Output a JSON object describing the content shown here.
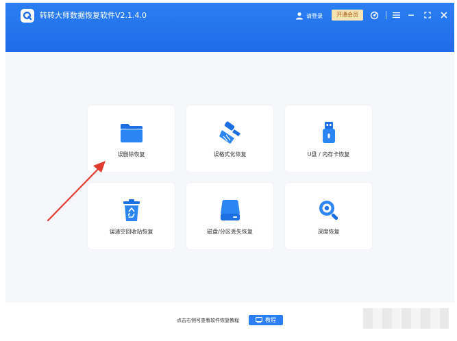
{
  "app": {
    "title": "转转大师数据恢复软件V2.1.4.0",
    "login_label": "请登录",
    "vip_label": "开通会员"
  },
  "colors": {
    "titlebar": "#1f6be8",
    "accent": "#2b7ff2",
    "vip_bg": "#f6e3b4",
    "vip_text": "#a0580e",
    "annotation_arrow": "#e23b2f"
  },
  "icons": {
    "logo": "logo-q-icon",
    "user": "user-icon",
    "support": "headset-icon",
    "menu": "menu-icon",
    "minimize": "minimize-icon",
    "maximize": "maximize-icon",
    "close": "close-icon"
  },
  "recovery_options": [
    {
      "label": "误删除恢复",
      "icon": "folder-icon"
    },
    {
      "label": "误格式化恢复",
      "icon": "broom-icon"
    },
    {
      "label": "U盘 / 内存卡恢复",
      "icon": "usb-drive-icon"
    },
    {
      "label": "误清空回收站恢复",
      "icon": "recycle-bin-icon"
    },
    {
      "label": "磁盘/分区丢失恢复",
      "icon": "disk-icon"
    },
    {
      "label": "深度恢复",
      "icon": "magnifier-icon"
    }
  ],
  "footer": {
    "hint": "点击右侧可查看软件恢复教程",
    "tutorial_label": "教程"
  }
}
